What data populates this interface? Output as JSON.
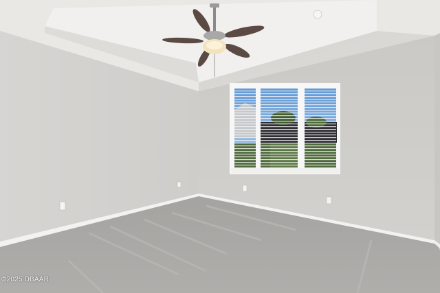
{
  "photo": {
    "watermark": "©2025 DBAAR",
    "colors": {
      "ceiling": "#ecebe8",
      "tray_ceiling": "#f3f2f0",
      "left_wall": "#d4d2cf",
      "back_wall": "#cdccc8",
      "right_wall": "#cfcdca",
      "carpet": "#a9a8a5",
      "baseboard": "#f2f2f0",
      "window_frame": "#f7f7f7",
      "sky": "#7eaee0",
      "foliage": "#4f6b3c",
      "fan_blade": "#5b4a43"
    }
  }
}
